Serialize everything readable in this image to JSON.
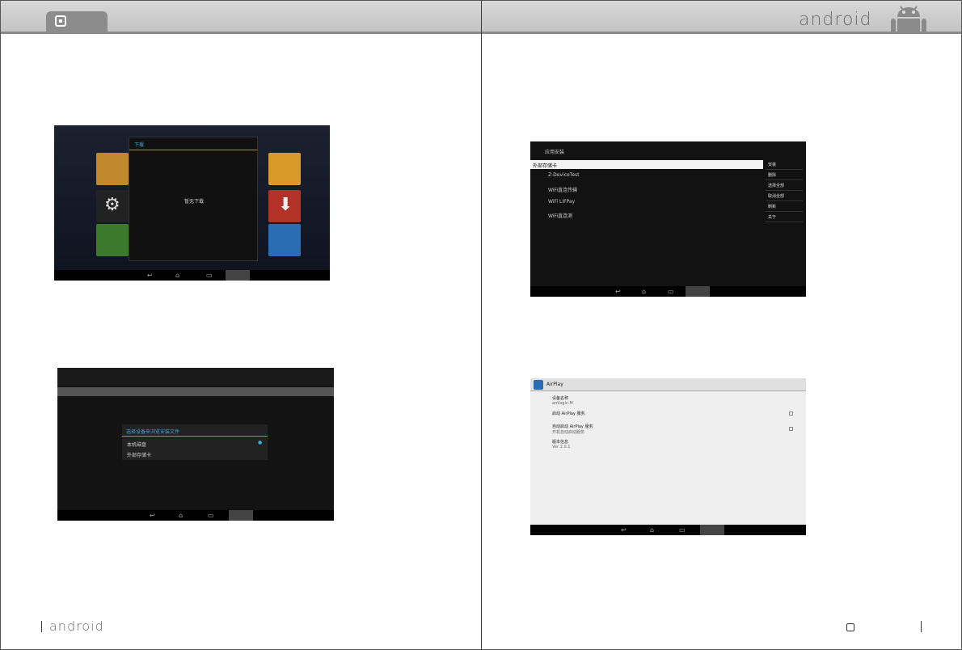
{
  "header": {
    "brand_word": "android"
  },
  "footer": {
    "brand_word": "android"
  },
  "shot1": {
    "dialog_title": "下载",
    "dialog_text": "暂无下载",
    "tile_labels": [
      "设置",
      "下载"
    ]
  },
  "shot2": {
    "dialog_title": "选择设备来浏览安装文件",
    "options": [
      "本机磁盘",
      "外部存储卡"
    ]
  },
  "shot3": {
    "app_title": "应用安装",
    "path": "外部存储卡",
    "files": [
      "Z-DeviceTest",
      "WiFi直连传输",
      "WiFi LIFPay",
      "WiFi直连测"
    ],
    "menu": [
      "安装",
      "删除",
      "选择全部",
      "取消全部",
      "刷新",
      "关于"
    ]
  },
  "shot4": {
    "app_title": "AirPlay",
    "rows": [
      {
        "t": "设备名称",
        "s": "amlogic-M"
      },
      {
        "t": "启动 AirPlay 服务",
        "s": ""
      },
      {
        "t": "自动启动 AirPlay 服务",
        "s": "开机自动启动服务"
      },
      {
        "t": "版本信息",
        "s": "Ver 2.0.1"
      }
    ]
  }
}
